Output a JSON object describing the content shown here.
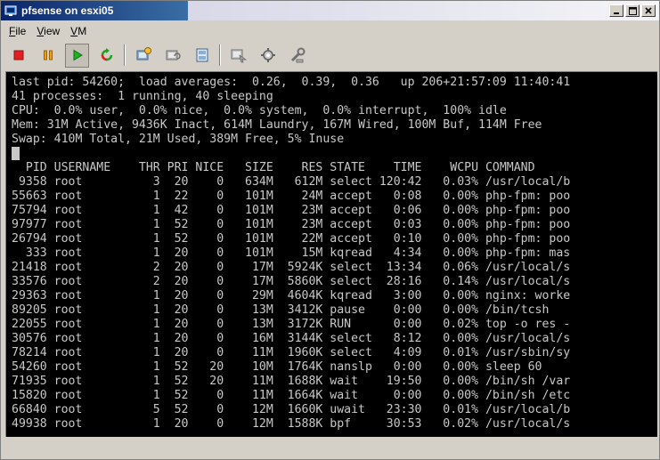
{
  "window": {
    "title": "pfsense on esxi05"
  },
  "menu": [
    {
      "label": "File",
      "key": "F",
      "rest": "ile"
    },
    {
      "label": "View",
      "key": "V",
      "rest": "iew"
    },
    {
      "label": "VM",
      "key": "V",
      "rest": "M"
    }
  ],
  "toolbar": {
    "icons": [
      "stop-icon",
      "pause-icon",
      "play-icon",
      "reset-icon",
      "snapshot-icon",
      "revert-snapshot-icon",
      "manage-snapshots-icon",
      "send-ctrl-alt-del-icon",
      "vm-settings-icon",
      "install-tools-icon"
    ]
  },
  "colors": {
    "console_bg": "#000000",
    "console_fg": "#c8c8c8",
    "title_bar": "#0a246a"
  },
  "console": {
    "lines": [
      "last pid: 54260;  load averages:  0.26,  0.39,  0.36   up 206+21:57:09 11:40:41",
      "41 processes:  1 running, 40 sleeping",
      "CPU:  0.0% user,  0.0% nice,  0.0% system,  0.0% interrupt,  100% idle",
      "Mem: 31M Active, 9436K Inact, 614M Laundry, 167M Wired, 100M Buf, 114M Free",
      "Swap: 410M Total, 21M Used, 389M Free, 5% Inuse",
      "",
      "  PID USERNAME    THR PRI NICE   SIZE    RES STATE    TIME    WCPU COMMAND",
      " 9358 root          3  20    0   634M   612M select 120:42   0.03% /usr/local/b",
      "55663 root          1  22    0   101M    24M accept   0:08   0.00% php-fpm: poo",
      "75794 root          1  42    0   101M    23M accept   0:06   0.00% php-fpm: poo",
      "97977 root          1  52    0   101M    23M accept   0:03   0.00% php-fpm: poo",
      "26794 root          1  52    0   101M    22M accept   0:10   0.00% php-fpm: poo",
      "  333 root          1  20    0   101M    15M kqread   4:34   0.00% php-fpm: mas",
      "21418 root          2  20    0    17M  5924K select  13:34   0.06% /usr/local/s",
      "33576 root          2  20    0    17M  5860K select  28:16   0.14% /usr/local/s",
      "29363 root          1  20    0    29M  4604K kqread   3:00   0.00% nginx: worke",
      "89205 root          1  20    0    13M  3412K pause    0:00   0.00% /bin/tcsh",
      "22055 root          1  20    0    13M  3172K RUN      0:00   0.02% top -o res -",
      "30576 root          1  20    0    16M  3144K select   8:12   0.00% /usr/local/s",
      "78214 root          1  20    0    11M  1960K select   4:09   0.01% /usr/sbin/sy",
      "54260 root          1  52   20    10M  1764K nanslp   0:00   0.00% sleep 60",
      "71935 root          1  52   20    11M  1688K wait    19:50   0.00% /bin/sh /var",
      "15820 root          1  52    0    11M  1664K wait     0:00   0.00% /bin/sh /etc",
      "66840 root          5  52    0    12M  1660K uwait   23:30   0.01% /usr/local/b",
      "49938 root          1  20    0    12M  1588K bpf     30:53   0.02% /usr/local/s"
    ]
  }
}
